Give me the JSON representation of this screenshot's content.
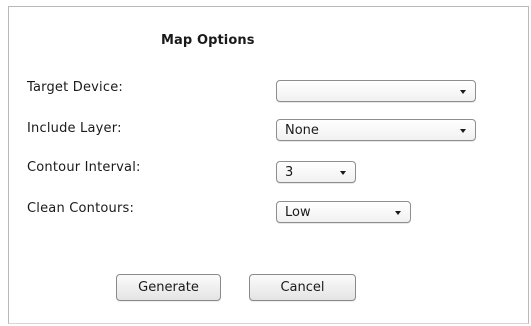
{
  "dialog": {
    "title": "Map Options",
    "fields": [
      {
        "label": "Target Device:",
        "value": ""
      },
      {
        "label": "Include Layer:",
        "value": "None"
      },
      {
        "label": "Contour Interval:",
        "value": "3"
      },
      {
        "label": "Clean Contours:",
        "value": "Low"
      }
    ],
    "buttons": {
      "generate": "Generate",
      "cancel": "Cancel"
    }
  },
  "colors": {
    "border": "#b9b9b9",
    "button_bg": "#e4e4e4",
    "text": "#1a1a1a"
  },
  "icons": {
    "dropdown": "chevron-down-icon"
  }
}
